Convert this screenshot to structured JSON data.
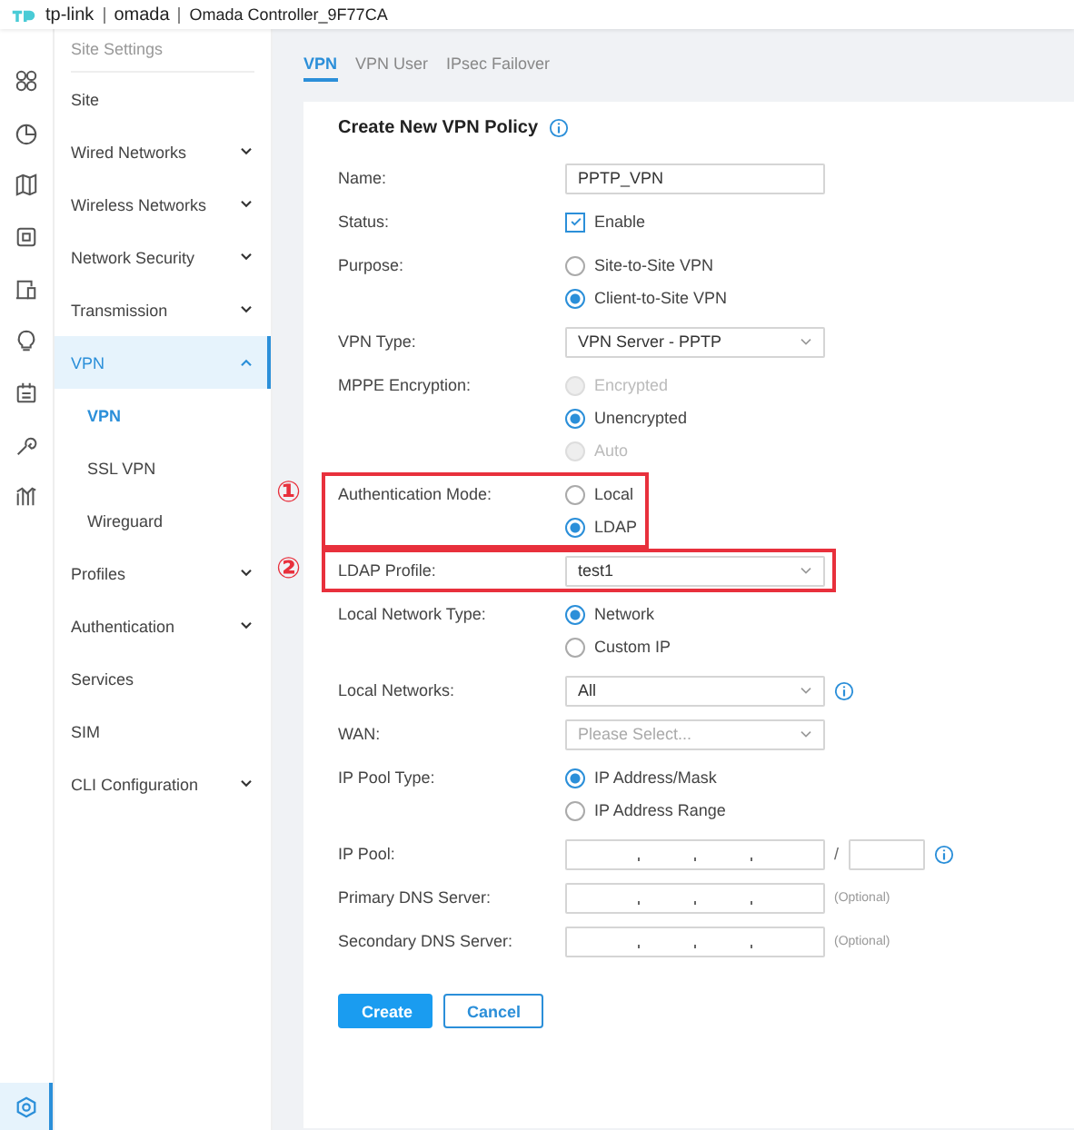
{
  "header": {
    "brand": "tp-link",
    "product": "omada",
    "controller": "Omada Controller_9F77CA"
  },
  "rail": {
    "items": [
      {
        "selected": false
      },
      {
        "selected": false
      },
      {
        "selected": false
      },
      {
        "selected": false
      },
      {
        "selected": false
      },
      {
        "selected": false
      },
      {
        "selected": false
      },
      {
        "selected": false
      },
      {
        "selected": false
      }
    ],
    "bottom": {
      "selected": true
    }
  },
  "sidebar": {
    "title": "Site Settings",
    "items": [
      {
        "label": "Site",
        "selected": false
      },
      {
        "label": "Wired Networks",
        "selected": false,
        "expanded": false
      },
      {
        "label": "Wireless Networks",
        "selected": false,
        "expanded": false
      },
      {
        "label": "Network Security",
        "selected": false,
        "expanded": false
      },
      {
        "label": "Transmission",
        "selected": false,
        "expanded": false
      },
      {
        "label": "VPN",
        "selected": true,
        "expanded": true,
        "children": [
          {
            "label": "VPN",
            "selected": true
          },
          {
            "label": "SSL VPN",
            "selected": false
          },
          {
            "label": "Wireguard",
            "selected": false
          }
        ]
      },
      {
        "label": "Profiles",
        "selected": false,
        "expanded": false
      },
      {
        "label": "Authentication",
        "selected": false,
        "expanded": false
      },
      {
        "label": "Services",
        "selected": false
      },
      {
        "label": "SIM",
        "selected": false
      },
      {
        "label": "CLI Configuration",
        "selected": false,
        "expanded": false
      }
    ]
  },
  "tabs": [
    {
      "label": "VPN",
      "selected": true
    },
    {
      "label": "VPN User",
      "selected": false
    },
    {
      "label": "IPsec Failover",
      "selected": false
    }
  ],
  "form": {
    "title": "Create New VPN Policy",
    "fields": [
      {
        "kind": "text",
        "label": "Name:",
        "value": "PPTP_VPN"
      },
      {
        "kind": "checkbox",
        "label": "Status:",
        "option": "Enable",
        "checked": true
      },
      {
        "kind": "radio",
        "label": "Purpose:",
        "options": [
          {
            "label": "Site-to-Site VPN",
            "selected": false,
            "disabled": false
          },
          {
            "label": "Client-to-Site VPN",
            "selected": true,
            "disabled": false
          }
        ]
      },
      {
        "kind": "select",
        "label": "VPN Type:",
        "value": "VPN Server - PPTP"
      },
      {
        "kind": "radio",
        "label": "MPPE Encryption:",
        "options": [
          {
            "label": "Encrypted",
            "selected": false,
            "disabled": true
          },
          {
            "label": "Unencrypted",
            "selected": true,
            "disabled": false
          },
          {
            "label": "Auto",
            "selected": false,
            "disabled": true
          }
        ]
      },
      {
        "kind": "radio",
        "label": "Authentication Mode:",
        "marker": "①",
        "options": [
          {
            "label": "Local",
            "selected": false,
            "disabled": false
          },
          {
            "label": "LDAP",
            "selected": true,
            "disabled": false
          }
        ]
      },
      {
        "kind": "select",
        "label": "LDAP Profile:",
        "marker": "②",
        "value": "test1"
      },
      {
        "kind": "radio",
        "label": "Local Network Type:",
        "options": [
          {
            "label": "Network",
            "selected": true,
            "disabled": false
          },
          {
            "label": "Custom IP",
            "selected": false,
            "disabled": false
          }
        ]
      },
      {
        "kind": "select",
        "label": "Local Networks:",
        "value": "All",
        "info": true
      },
      {
        "kind": "select",
        "label": "WAN:",
        "placeholder": "Please Select..."
      },
      {
        "kind": "radio",
        "label": "IP Pool Type:",
        "options": [
          {
            "label": "IP Address/Mask",
            "selected": true,
            "disabled": false
          },
          {
            "label": "IP Address Range",
            "selected": false,
            "disabled": false
          }
        ]
      },
      {
        "kind": "ip",
        "label": "IP Pool:",
        "mask_separator": "/",
        "info": true
      },
      {
        "kind": "ip",
        "label": "Primary DNS Server:",
        "note": "(Optional)"
      },
      {
        "kind": "ip",
        "label": "Secondary DNS Server:",
        "note": "(Optional)"
      }
    ],
    "buttons": [
      {
        "label": "Create",
        "kind": "primary"
      },
      {
        "label": "Cancel",
        "kind": "secondary"
      }
    ]
  }
}
